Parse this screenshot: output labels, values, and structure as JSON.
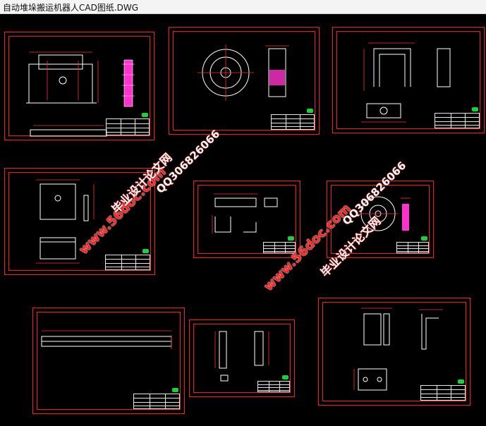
{
  "window": {
    "title": "自动堆垛搬运机器人CAD图纸.DWG"
  },
  "watermarks": {
    "site": "www.56doc.com",
    "qq": "QQ306826066",
    "brand": "毕业设计论文网"
  },
  "colors": {
    "background": "#000000",
    "sheet_border": "#ff1a1a",
    "geometry": "#ffffff",
    "dimension": "#ff3030",
    "logo": "#19d23a",
    "highlight": "#ff33cc"
  },
  "sheets": [
    "sheet-1-base-plate",
    "sheet-2-gear-wheel",
    "sheet-3-u-bracket",
    "sheet-4-block-part",
    "sheet-5-angle-plate",
    "sheet-6-pulley",
    "sheet-7-rack-bar",
    "sheet-8-rod-parts",
    "sheet-9-bracket-assembly"
  ]
}
